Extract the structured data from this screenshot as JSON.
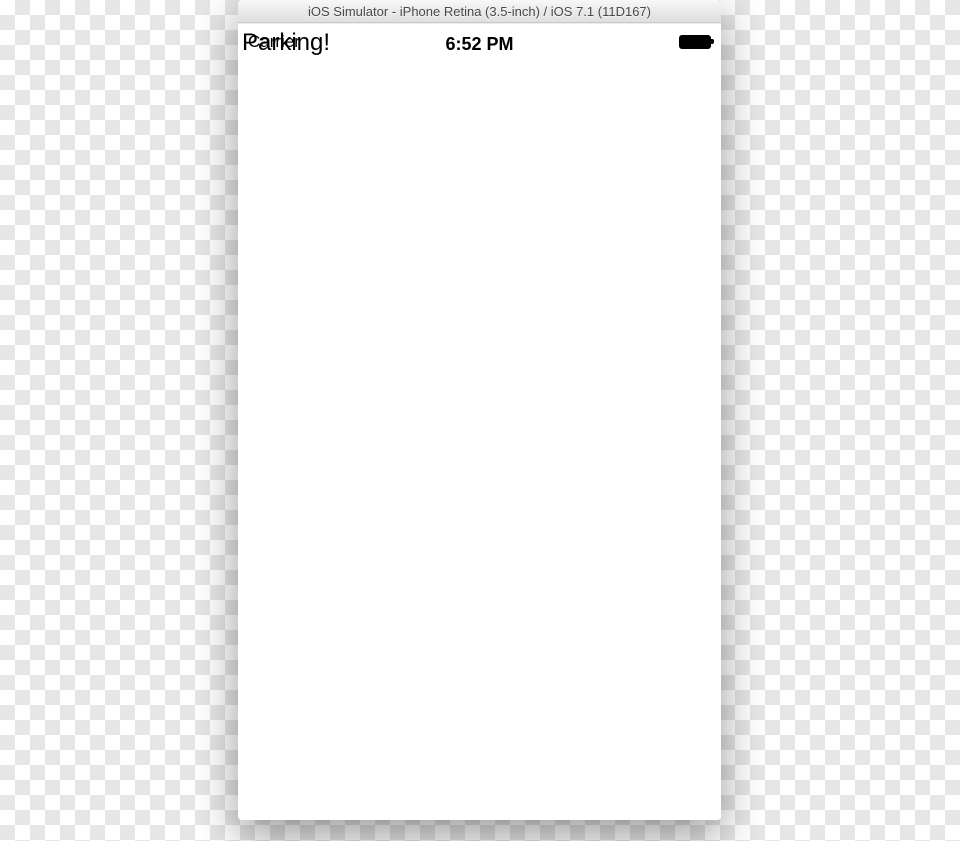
{
  "window": {
    "title": "iOS Simulator - iPhone Retina (3.5-inch) / iOS 7.1 (11D167)"
  },
  "status_bar": {
    "carrier_text": "Carrier",
    "clock": "6:52 PM"
  },
  "overlap_label": "Parking!"
}
